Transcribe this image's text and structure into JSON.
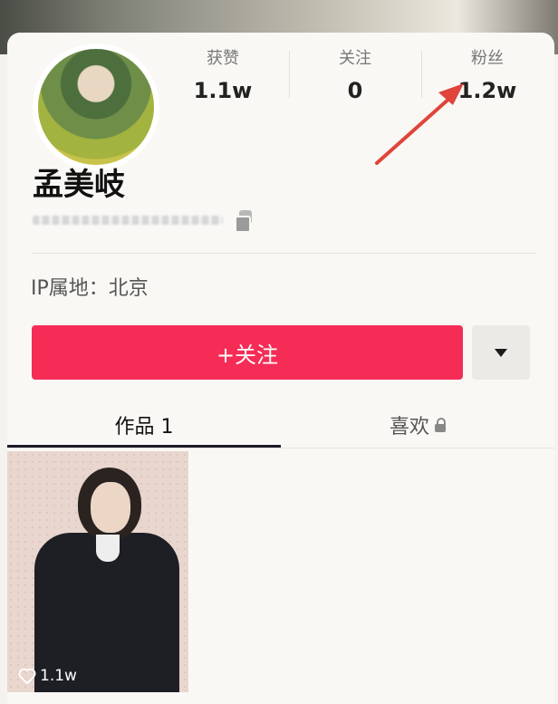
{
  "stats": [
    {
      "label": "获赞",
      "value": "1.1w"
    },
    {
      "label": "关注",
      "value": "0"
    },
    {
      "label": "粉丝",
      "value": "1.2w"
    }
  ],
  "profile": {
    "name": "孟美岐",
    "ip_location": "IP属地：北京"
  },
  "actions": {
    "follow_label": "+关注"
  },
  "tabs": {
    "works": "作品 1",
    "likes": "喜欢"
  },
  "works": [
    {
      "likes": "1.1w"
    }
  ],
  "colors": {
    "accent": "#f52c56",
    "annotation_arrow": "#e0443a"
  },
  "icons": [
    "copy-icon",
    "chevron-down-icon",
    "lock-icon",
    "heart-icon",
    "arrow-annotation"
  ]
}
